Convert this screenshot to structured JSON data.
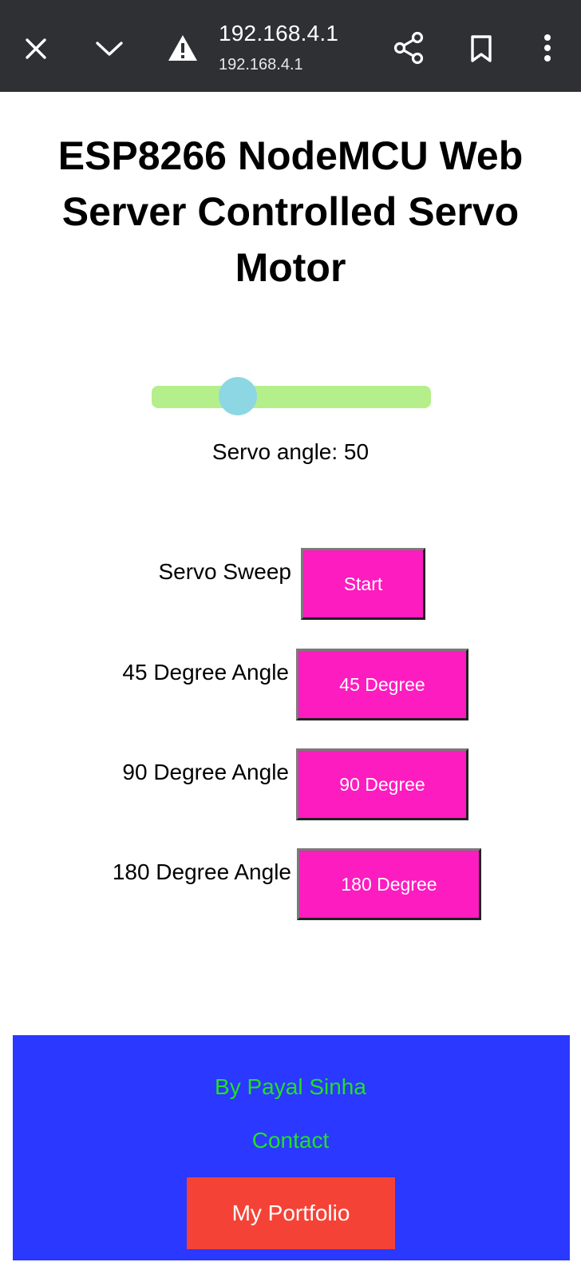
{
  "browser": {
    "url_title": "192.168.4.1",
    "url_subtitle": "192.168.4.1",
    "icons": [
      "close-icon",
      "chevron-down-icon",
      "warning-icon",
      "share-icon",
      "bookmark-icon",
      "more-vert-icon"
    ],
    "bar_color": "#2f3034"
  },
  "page": {
    "title": "ESP8266 NodeMCU Web Server Controlled Servo Motor",
    "slider": {
      "value": 50,
      "min": 0,
      "max": 180,
      "track_color": "#b4ef8c",
      "thumb_color": "#8dd6e3"
    },
    "servo_angle_text": "Servo angle: 50",
    "controls": [
      {
        "label": "Servo Sweep",
        "button": "Start"
      },
      {
        "label": "45 Degree Angle",
        "button": "45 Degree"
      },
      {
        "label": "90 Degree Angle",
        "button": "90 Degree"
      },
      {
        "label": "180 Degree Angle",
        "button": "180 Degree"
      }
    ],
    "button_color": "#fc1cbf"
  },
  "footer": {
    "author": "By Payal Sinha",
    "contact": "Contact",
    "portfolio_button": "My Portfolio",
    "background_color": "#2b38ff",
    "link_color": "#22e022",
    "portfolio_color": "#f44336"
  }
}
